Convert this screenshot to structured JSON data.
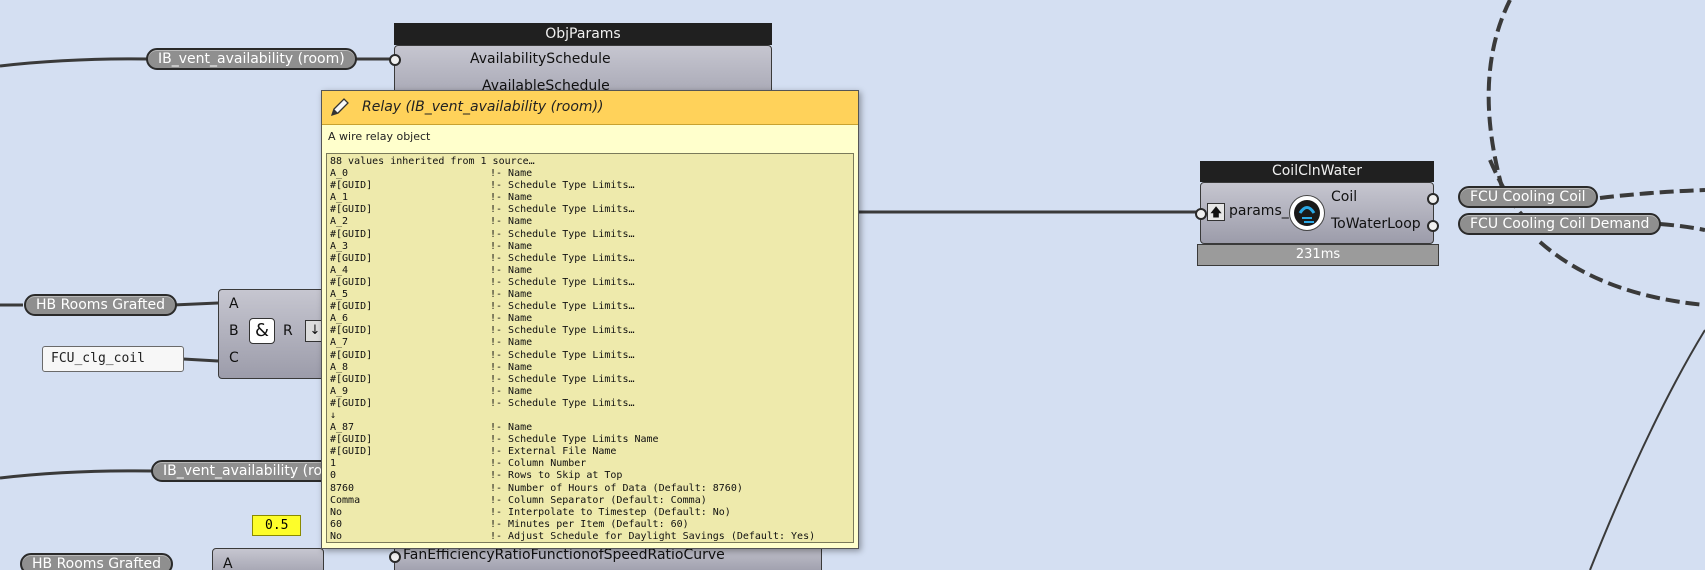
{
  "canvas": {
    "background": "#d4dff2",
    "chips": {
      "ib_vent_top": "IB_vent_availability (room)",
      "hb_rooms_1": "HB Rooms Grafted",
      "ib_vent_bottom": "IB_vent_availability (room)",
      "hb_rooms_2": "HB Rooms Grafted",
      "fcu_cooling_coil": "FCU Cooling Coil",
      "fcu_cooling_coil_demand": "FCU Cooling Coil Demand"
    },
    "panels": {
      "fcu_clg_coil": "FCU_clg_coil",
      "num_value": "0.5"
    }
  },
  "objparams": {
    "title": "ObjParams",
    "inputs": [
      "AvailabilitySchedule",
      "AvailableSchedule"
    ],
    "footer_input": "FanEfficiencyRatioFunctionofSpeedRatioCurve"
  },
  "merge_component": {
    "inputs": [
      "A",
      "B",
      "C"
    ],
    "output": "R"
  },
  "bottom_component": {
    "input": "A"
  },
  "coilclnwater": {
    "title": "CoilClnWater",
    "input": "params_",
    "outputs": [
      "Coil",
      "ToWaterLoop"
    ],
    "timer": "231ms"
  },
  "tooltip": {
    "title": "Relay (IB_vent_availability (room))",
    "description": "A wire relay object",
    "header_line": "88 values inherited from 1 source…",
    "rows": [
      {
        "k": "A_0",
        "c": "!- Name"
      },
      {
        "k": "#[GUID]",
        "c": "!- Schedule Type Limits…"
      },
      {
        "k": "A_1",
        "c": "!- Name"
      },
      {
        "k": "#[GUID]",
        "c": "!- Schedule Type Limits…"
      },
      {
        "k": "A_2",
        "c": "!- Name"
      },
      {
        "k": "#[GUID]",
        "c": "!- Schedule Type Limits…"
      },
      {
        "k": "A_3",
        "c": "!- Name"
      },
      {
        "k": "#[GUID]",
        "c": "!- Schedule Type Limits…"
      },
      {
        "k": "A_4",
        "c": "!- Name"
      },
      {
        "k": "#[GUID]",
        "c": "!- Schedule Type Limits…"
      },
      {
        "k": "A_5",
        "c": "!- Name"
      },
      {
        "k": "#[GUID]",
        "c": "!- Schedule Type Limits…"
      },
      {
        "k": "A_6",
        "c": "!- Name"
      },
      {
        "k": "#[GUID]",
        "c": "!- Schedule Type Limits…"
      },
      {
        "k": "A_7",
        "c": "!- Name"
      },
      {
        "k": "#[GUID]",
        "c": "!- Schedule Type Limits…"
      },
      {
        "k": "A_8",
        "c": "!- Name"
      },
      {
        "k": "#[GUID]",
        "c": "!- Schedule Type Limits…"
      },
      {
        "k": "A_9",
        "c": "!- Name"
      },
      {
        "k": "#[GUID]",
        "c": "!- Schedule Type Limits…"
      },
      {
        "k": "  ↓",
        "c": ""
      },
      {
        "k": "A_87",
        "c": "!- Name"
      },
      {
        "k": "#[GUID]",
        "c": "!- Schedule Type Limits Name"
      },
      {
        "k": "#[GUID]",
        "c": "!- External File Name"
      },
      {
        "k": "1",
        "c": "!- Column Number"
      },
      {
        "k": "0",
        "c": "!- Rows to Skip at Top"
      },
      {
        "k": "8760",
        "c": "!- Number of Hours of Data (Default: 8760)"
      },
      {
        "k": "Comma",
        "c": "!- Column Separator (Default: Comma)"
      },
      {
        "k": "No",
        "c": "!- Interpolate to Timestep (Default: No)"
      },
      {
        "k": "60",
        "c": "!- Minutes per Item (Default: 60)"
      },
      {
        "k": "No",
        "c": "!- Adjust Schedule for Daylight Savings (Default: Yes)"
      }
    ]
  }
}
